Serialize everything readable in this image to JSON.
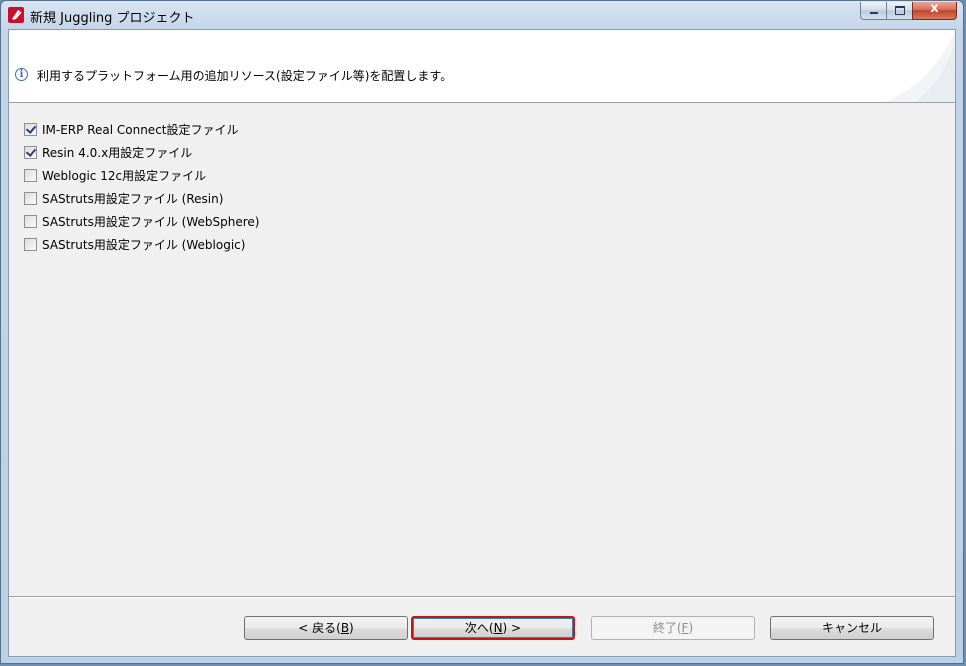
{
  "window": {
    "title": "新規 Juggling プロジェクト",
    "controls": {
      "close_glyph": "x"
    }
  },
  "header": {
    "icon": "info-icon",
    "message": "利用するプラットフォーム用の追加リソース(設定ファイル等)を配置します。"
  },
  "options": [
    {
      "label": "IM-ERP Real Connect設定ファイル",
      "checked": true
    },
    {
      "label": "Resin 4.0.x用設定ファイル",
      "checked": true
    },
    {
      "label": "Weblogic 12c用設定ファイル",
      "checked": false
    },
    {
      "label": "SAStruts用設定ファイル (Resin)",
      "checked": false
    },
    {
      "label": "SAStruts用設定ファイル (WebSphere)",
      "checked": false
    },
    {
      "label": "SAStruts用設定ファイル (Weblogic)",
      "checked": false
    }
  ],
  "buttons": {
    "back": {
      "prefix": "< 戻る(",
      "mnemonic": "B",
      "suffix": ")"
    },
    "next": {
      "prefix": "次へ(",
      "mnemonic": "N",
      "suffix": ") >"
    },
    "finish": {
      "prefix": "終了(",
      "mnemonic": "F",
      "suffix": ")"
    },
    "cancel": {
      "label": "キャンセル"
    }
  },
  "colors": {
    "accent_default_button": "#c01818",
    "app_icon": "#c8102e"
  }
}
